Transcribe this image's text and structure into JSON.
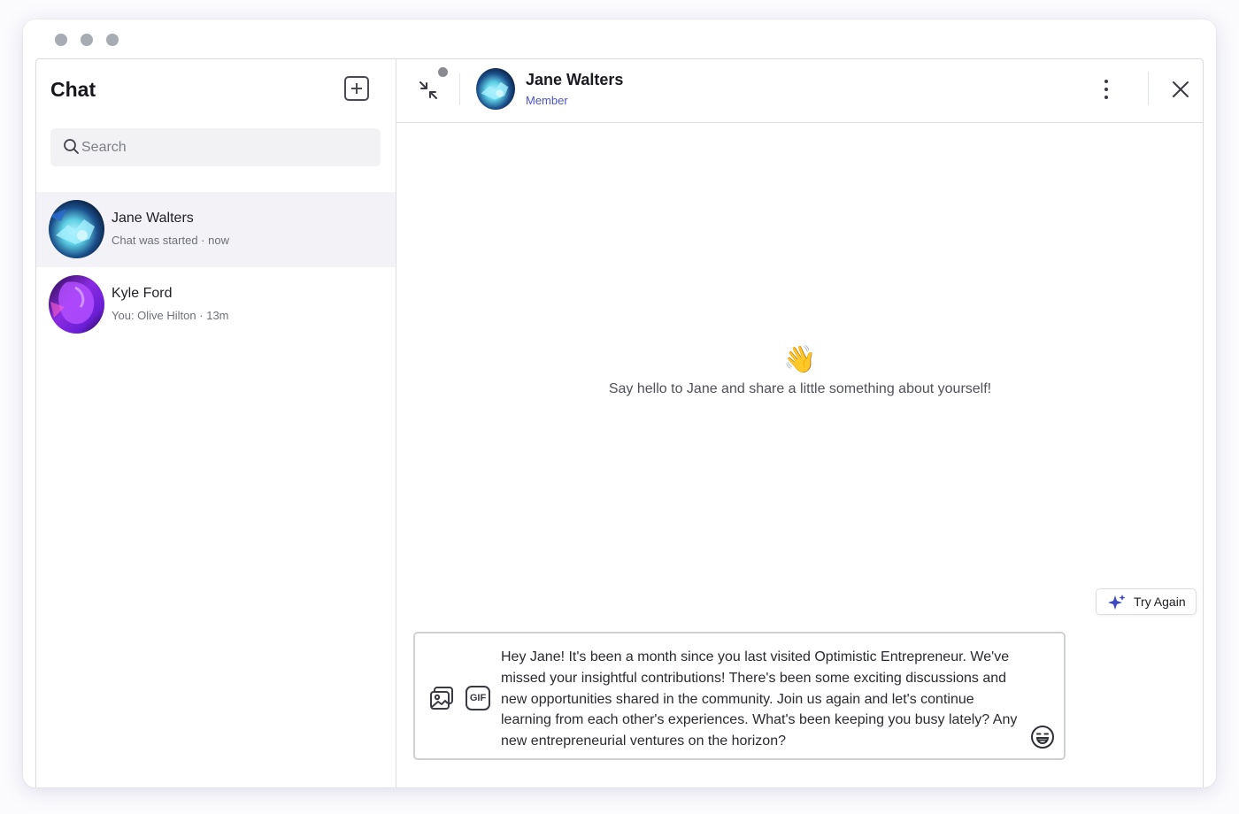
{
  "window": {
    "traffic_lights": [
      "close",
      "minimize",
      "zoom"
    ]
  },
  "sidebar": {
    "title": "Chat",
    "new_chat_icon": "plus-square-icon",
    "search": {
      "placeholder": "Search",
      "icon": "search-icon"
    },
    "conversations": [
      {
        "name": "Jane Walters",
        "preview": "Chat was started",
        "time": "now",
        "separator": "·",
        "active": true
      },
      {
        "name": "Kyle Ford",
        "preview": "You: Olive Hilton ",
        "time": "13m",
        "separator": "·",
        "active": false
      }
    ]
  },
  "chat": {
    "header": {
      "name": "Jane Walters",
      "role": "Member",
      "collapse_icon": "collapse-arrows-icon",
      "more_icon": "kebab-menu-icon",
      "close_icon": "close-icon"
    },
    "empty_state": {
      "emoji": "👋",
      "text": "Say hello to Jane and share a little something about yourself!"
    },
    "try_again": {
      "label": "Try Again",
      "icon": "sparkle-icon"
    },
    "composer": {
      "message": "Hey Jane! It's been a month since you last visited Optimistic Entrepreneur. We've missed your insightful contributions! There's been some exciting discussions and new opportunities shared in the community. Join us again and let's continue learning from each other's experiences. What's been keeping you busy lately? Any new entrepreneurial ventures on the horizon?",
      "gif_label": "GIF",
      "image_icon": "image-gallery-icon",
      "emoji_icon": "emoji-icon"
    }
  },
  "colors": {
    "accent": "#4b55c8",
    "active_row": "#f3f3f7",
    "border": "#dedfe3"
  }
}
